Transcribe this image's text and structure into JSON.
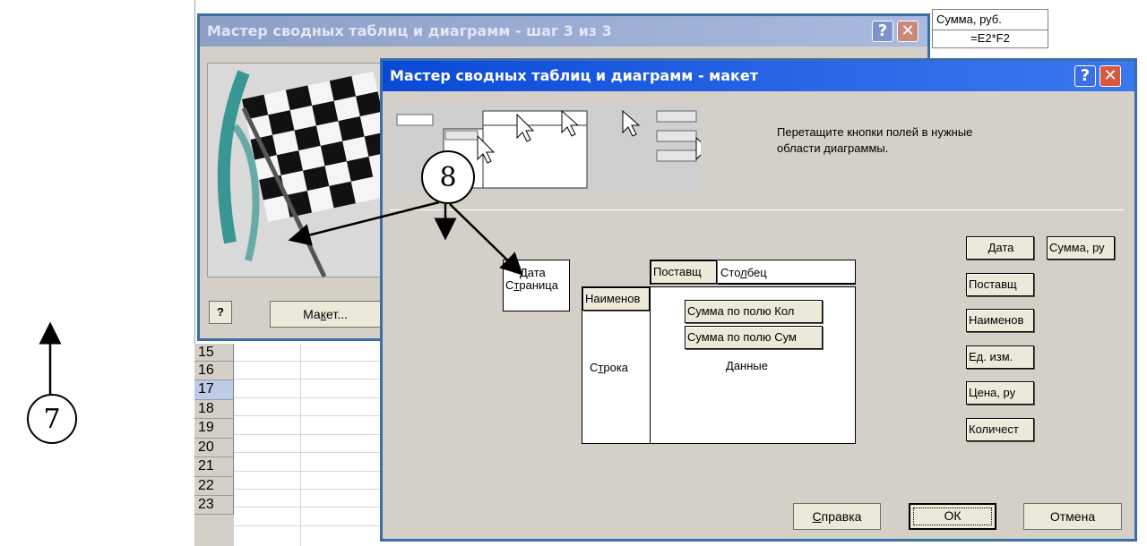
{
  "spreadsheet": {
    "header_cell": "Сумма, руб.",
    "formula_cell": "=E2*F2",
    "row_numbers": [
      "15",
      "16",
      "17",
      "18",
      "19",
      "20",
      "21",
      "22",
      "23"
    ]
  },
  "step_dialog": {
    "title": "Мастер сводных таблиц и диаграмм - шаг 3 из 3",
    "help_title_btn": "?",
    "close_title_btn": "✕",
    "help_btn": "?",
    "layout_btn_prefix": "Ма",
    "layout_btn_underlined": "к",
    "layout_btn_suffix": "ет..."
  },
  "layout_dialog": {
    "title": "Мастер сводных таблиц и диаграмм - макет",
    "help_title_btn": "?",
    "close_title_btn": "✕",
    "instruction_line1": "Перетащите кнопки полей в нужные",
    "instruction_line2": "области диаграммы.",
    "page_area": {
      "line1": "Дата",
      "line2_prefix": "С",
      "line2_underlined": "т",
      "line2_suffix": "раница"
    },
    "column_field": "Поставщ",
    "column_label_prefix": "Сто",
    "column_label_underlined": "л",
    "column_label_suffix": "бец",
    "row_field": "Наименов",
    "row_label_prefix": "С",
    "row_label_underlined": "т",
    "row_label_suffix": "рока",
    "data_fields": [
      "Сумма по полю Кол",
      "Сумма по полю Сум"
    ],
    "data_label_prefix": "",
    "data_label_underlined": "Д",
    "data_label_suffix": "анные",
    "available_fields": [
      "Дата",
      "Поставщ",
      "Наименов",
      "Ед. изм.",
      "Цена, ру",
      "Количест"
    ],
    "available_field_extra": "Сумма, ру",
    "buttons": {
      "help_prefix": "",
      "help_underlined": "С",
      "help_suffix": "правка",
      "ok": "ОК",
      "cancel": "Отмена"
    }
  },
  "annotations": {
    "callout_7": "7",
    "callout_8": "8"
  }
}
